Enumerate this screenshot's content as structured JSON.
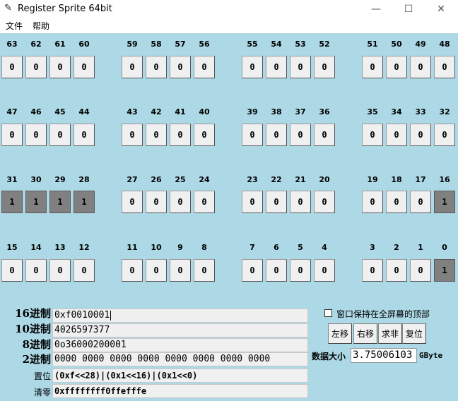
{
  "window": {
    "title": "Register Sprite 64bit",
    "minimize": "—",
    "maximize": "☐",
    "close": "✕"
  },
  "menu": [
    "文件",
    "帮助"
  ],
  "bits": {
    "63": 0,
    "62": 0,
    "61": 0,
    "60": 0,
    "59": 0,
    "58": 0,
    "57": 0,
    "56": 0,
    "55": 0,
    "54": 0,
    "53": 0,
    "52": 0,
    "51": 0,
    "50": 0,
    "49": 0,
    "48": 0,
    "47": 0,
    "46": 0,
    "45": 0,
    "44": 0,
    "43": 0,
    "42": 0,
    "41": 0,
    "40": 0,
    "39": 0,
    "38": 0,
    "37": 0,
    "36": 0,
    "35": 0,
    "34": 0,
    "33": 0,
    "32": 0,
    "31": 1,
    "30": 1,
    "29": 1,
    "28": 1,
    "27": 0,
    "26": 0,
    "25": 0,
    "24": 0,
    "23": 0,
    "22": 0,
    "21": 0,
    "20": 0,
    "19": 0,
    "18": 0,
    "17": 0,
    "16": 1,
    "15": 0,
    "14": 0,
    "13": 0,
    "12": 0,
    "11": 0,
    "10": 0,
    "9": 0,
    "8": 0,
    "7": 0,
    "6": 0,
    "5": 0,
    "4": 0,
    "3": 0,
    "2": 0,
    "1": 0,
    "0": 1
  },
  "colors": {
    "background": "#add8e6",
    "bit_on": "#808080",
    "bit_off": "#f0f0f0"
  },
  "fields": {
    "hex_label": "16进制",
    "hex_value": "0xf0010001",
    "dec_label": "10进制",
    "dec_value": "4026597377",
    "oct_label": "8进制",
    "oct_value": "0o36000200001",
    "bin_label": "2进制",
    "bin_value": "0000 0000 0000 0000 0000 0000 0000 0000",
    "set_label": "置位",
    "set_value": "(0xf<<28)|(0x1<<16)|(0x1<<0)",
    "clear_label": "清零",
    "clear_value": "0xffffffff0ffefffe"
  },
  "options": {
    "always_on_top_label": "窗口保持在全屏幕的顶部",
    "always_on_top_checked": false
  },
  "actions": {
    "shift_left": "左移",
    "shift_right": "右移",
    "invert": "求非",
    "reset": "复位"
  },
  "size": {
    "label": "数据大小",
    "value": "3.75006103",
    "unit": "GByte"
  }
}
